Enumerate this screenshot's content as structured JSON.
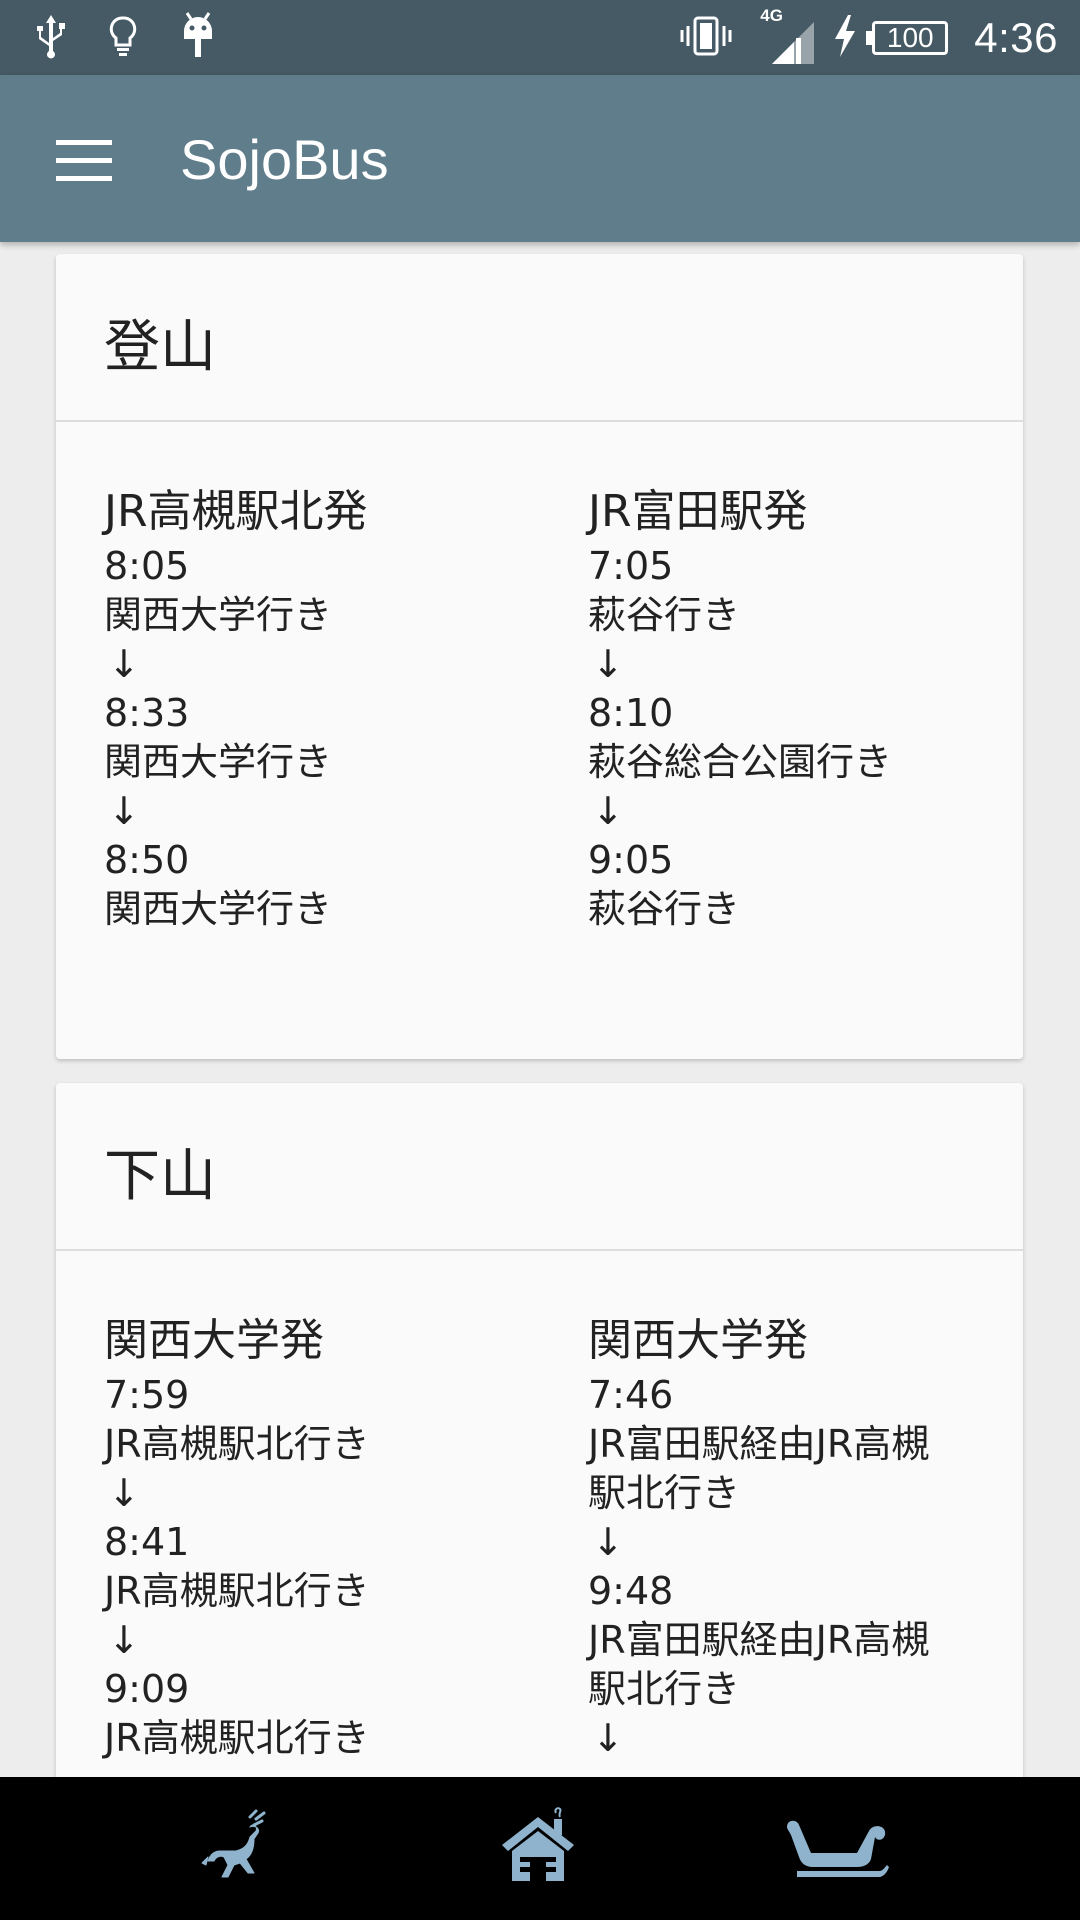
{
  "status_bar": {
    "network": "4G",
    "battery": "100",
    "time": "4:36",
    "icons": [
      "usb-icon",
      "lightbulb-icon",
      "android-debug-icon",
      "vibrate-icon",
      "signal-icon",
      "charging-icon",
      "battery-icon"
    ]
  },
  "app_bar": {
    "title": "SojoBus",
    "menu_icon": "hamburger-menu-icon"
  },
  "sections": [
    {
      "title": "登山",
      "columns": [
        {
          "heading": "JR高槻駅北発",
          "entries": [
            {
              "time": "8:05",
              "destination": "関西大学行き"
            },
            {
              "time": "8:33",
              "destination": "関西大学行き"
            },
            {
              "time": "8:50",
              "destination": "関西大学行き"
            }
          ]
        },
        {
          "heading": "JR富田駅発",
          "entries": [
            {
              "time": "7:05",
              "destination": "萩谷行き"
            },
            {
              "time": "8:10",
              "destination": "萩谷総合公園行き"
            },
            {
              "time": "9:05",
              "destination": "萩谷行き"
            }
          ]
        }
      ]
    },
    {
      "title": "下山",
      "columns": [
        {
          "heading": "関西大学発",
          "entries": [
            {
              "time": "7:59",
              "destination": "JR高槻駅北行き"
            },
            {
              "time": "8:41",
              "destination": "JR高槻駅北行き"
            },
            {
              "time": "9:09",
              "destination": "JR高槻駅北行き"
            }
          ]
        },
        {
          "heading": "関西大学発",
          "entries": [
            {
              "time": "7:46",
              "destination": "JR富田駅経由JR高槻駅北行き"
            },
            {
              "time": "9:48",
              "destination": "JR富田駅経由JR高槻駅北行き"
            }
          ]
        }
      ]
    }
  ],
  "arrow": "↓",
  "bottom_nav": {
    "items": [
      {
        "icon": "reindeer-icon"
      },
      {
        "icon": "home-icon"
      },
      {
        "icon": "sleigh-icon"
      }
    ],
    "icon_color": "#8fb3cc"
  },
  "colors": {
    "status_bar": "#455a64",
    "app_bar": "#607d8b",
    "card_background": "#fafafa",
    "page_background": "#ededed"
  }
}
